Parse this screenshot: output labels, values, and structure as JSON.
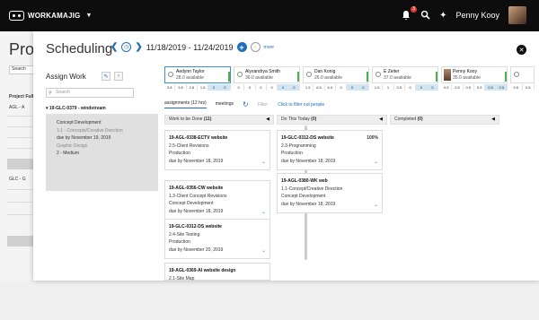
{
  "topbar": {
    "brand": "WORKAMAJIG",
    "notifications": "3",
    "user_name": "Penny Kooy"
  },
  "background_page": {
    "title": "Proje",
    "search_placeholder": "Search",
    "column_header": "Project Full",
    "rows": [
      "AGL - A",
      "GLC - G"
    ]
  },
  "modal": {
    "title": "Scheduling",
    "date_range": "11/18/2019 - 11/24/2019",
    "more_label": "more"
  },
  "assign_work": {
    "title": "Assign Work",
    "search_placeholder": "Search",
    "project": "19-GLC-0379 - windstream",
    "task": {
      "name": "Concept Development",
      "subtask": "1.1 - Concepts/Creative Direction",
      "due": "due by November 19, 2019",
      "department": "Graphic Design",
      "priority": "2 - Medium"
    }
  },
  "team": [
    {
      "name": "Aedynn Taylor",
      "available": "28.0 available",
      "hours": [
        "3.8",
        "3.8",
        "2.8",
        "1.8",
        "0",
        "0"
      ],
      "selected": true
    },
    {
      "name": "Alyxandrya Smith",
      "available": "36.0 available",
      "hours": [
        "0",
        "0",
        "0",
        "0",
        "0",
        "0"
      ],
      "selected": false
    },
    {
      "name": "Dan Konig",
      "available": "26.0 available",
      "hours": [
        "1.5",
        "6.5",
        "6.0",
        "0",
        "0",
        "0"
      ],
      "selected": false
    },
    {
      "name": "E Zeiter",
      "available": "37.0 available",
      "hours": [
        "1.5",
        "1",
        "0.5",
        "0",
        "0",
        "0"
      ],
      "selected": false
    },
    {
      "name": "Penny Kooy",
      "available": "35.0 available",
      "hours": [
        "0.5",
        "0.5",
        "0.5",
        "0.5",
        "0.5",
        "0.5"
      ],
      "selected": false
    },
    {
      "name": "",
      "available": "",
      "hours": [
        "0.5",
        "0.5"
      ],
      "selected": false
    }
  ],
  "tabs": {
    "assignments": "assignments (12 hrs)",
    "meetings": "meetings",
    "filter_label": "Filter:",
    "filter_link": "Click to filter out people"
  },
  "columns": {
    "work_to_be_done": {
      "label": "Work to be Done",
      "count": "(11)"
    },
    "do_this_today": {
      "label": "Do This Today",
      "count": "(0)"
    },
    "completed": {
      "label": "Completed",
      "count": "(0)"
    }
  },
  "work_cards": [
    {
      "title": "19-AGL-0338-ECTV website",
      "sub": "2.5-Client Revisions",
      "dept": "Production",
      "due": "due by November 18, 2019"
    },
    {
      "title": "19-AGL-0356-CW website",
      "sub": "1.3-Client Concept Revisions",
      "dept": "Concept Development",
      "due": "due by November 18, 2019"
    },
    {
      "title": "19-GLC-0312-DS website",
      "sub": "2.4-Site Testing",
      "dept": "Production",
      "due": "due by November 20, 2019"
    },
    {
      "title": "19-AGL-0369-AI website design",
      "sub": "2.1-Site Map",
      "dept": "",
      "due": ""
    }
  ],
  "today_cards": [
    {
      "title": "19-GLC-0312-DS website",
      "pct": "100%",
      "sub": "2.3-Programming",
      "dept": "Production",
      "due": "due by November 18, 2019"
    },
    {
      "title": "19-AGL-0380-WK web",
      "sub": "1.1-Concept/Creative Direction",
      "dept": "Concept Development",
      "due": "due by November 18, 2019"
    }
  ]
}
